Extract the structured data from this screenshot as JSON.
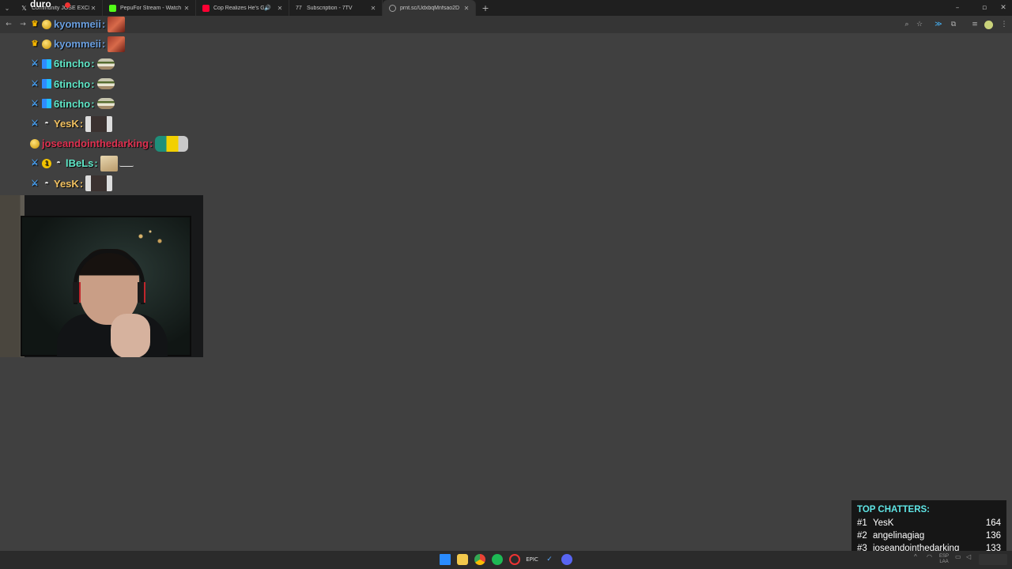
{
  "browser": {
    "tabs": [
      {
        "title": "Community JOSÉ EXCLUSIVE",
        "favicon": "x-icon",
        "color": "#e0e0e0",
        "active": false,
        "audio": false
      },
      {
        "title": "PepuFor Stream - Watch Live o",
        "favicon": "kick-icon",
        "color": "#53fc18",
        "active": false,
        "audio": false
      },
      {
        "title": "Cop Realizes He's Getting S",
        "favicon": "youtube-icon",
        "color": "#ff0033",
        "active": false,
        "audio": true
      },
      {
        "title": "Subscription - 7TV",
        "favicon": "7tv-icon",
        "color": "#cfcfcf",
        "active": false,
        "audio": false
      },
      {
        "title": "prnt.sc/UdxbqMnfsao2D",
        "favicon": "link-icon",
        "color": "#a0a0a0",
        "active": true,
        "audio": false
      }
    ],
    "close_glyph": "✕",
    "new_tab_glyph": "+"
  },
  "overlay": {
    "caption": "duro"
  },
  "chat": {
    "messages": [
      {
        "badges": [
          "crown-badge",
          "gold-badge"
        ],
        "user": "kyommeii",
        "color": "#6a9fe0",
        "emotes": [
          "red-emote"
        ]
      },
      {
        "badges": [
          "crown-badge",
          "gold-badge"
        ],
        "user": "kyommeii",
        "color": "#6a9fe0",
        "emotes": [
          "red-emote"
        ]
      },
      {
        "badges": [
          "sword-badge",
          "grid-badge"
        ],
        "user": "6tincho",
        "color": "#5fe8c8",
        "emotes": [
          "burger-emote"
        ]
      },
      {
        "badges": [
          "sword-badge",
          "grid-badge"
        ],
        "user": "6tincho",
        "color": "#5fe8c8",
        "emotes": [
          "burger-emote"
        ]
      },
      {
        "badges": [
          "sword-badge",
          "grid-badge"
        ],
        "user": "6tincho",
        "color": "#5fe8c8",
        "emotes": [
          "burger-emote"
        ]
      },
      {
        "badges": [
          "sword-badge",
          "bowl-badge"
        ],
        "user": "YesK",
        "color": "#f0c060",
        "emotes": [
          "face-emote"
        ]
      },
      {
        "badges": [
          "gold-badge"
        ],
        "user": "joseandointhedarking",
        "color": "#e03050",
        "emotes": [
          "combo-emote"
        ]
      },
      {
        "badges": [
          "sword-badge",
          "one-badge",
          "bowl-badge"
        ],
        "user": "lBeLs",
        "color": "#5fe8c8",
        "emotes": [
          "dog-emote",
          "small-emote"
        ]
      },
      {
        "badges": [
          "sword-badge",
          "bowl-badge"
        ],
        "user": "YesK",
        "color": "#f0c060",
        "emotes": [
          "face-emote"
        ]
      }
    ],
    "separator": ":"
  },
  "top_chatters": {
    "title": "TOP CHATTERS:",
    "title_color": "#5fe6e6",
    "entries": [
      {
        "rank": "#1",
        "name": "YesK",
        "count": "164"
      },
      {
        "rank": "#2",
        "name": "angelinagiag",
        "count": "136"
      },
      {
        "rank": "#3",
        "name": "joseandointhedarking",
        "count": "133"
      }
    ]
  },
  "tray": {
    "lang_top": "ESP",
    "lang_bottom": "LAA"
  }
}
